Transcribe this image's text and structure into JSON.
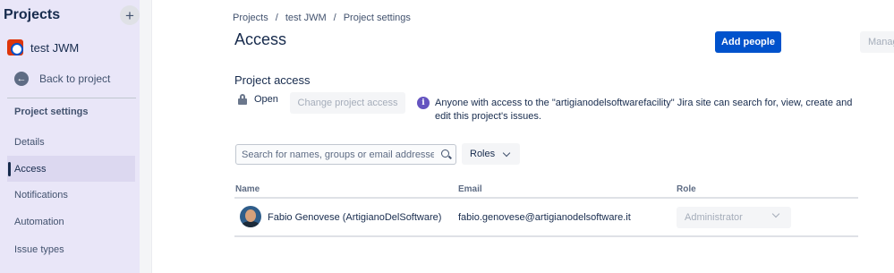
{
  "sidebar": {
    "header": "Projects",
    "add_label": "+",
    "project_name": "test JWM",
    "back_label": "Back to project",
    "section_title": "Project settings",
    "items": [
      {
        "label": "Details"
      },
      {
        "label": "Access"
      },
      {
        "label": "Notifications"
      },
      {
        "label": "Automation"
      },
      {
        "label": "Issue types"
      }
    ],
    "active_item": "Access"
  },
  "breadcrumb": [
    "Projects",
    "/",
    "test JWM",
    "/",
    "Project settings"
  ],
  "page": {
    "title": "Access",
    "add_people_label": "Add people",
    "manage_label": "Manag"
  },
  "project_access": {
    "title": "Project access",
    "status": "Open",
    "change_label": "Change project access",
    "info_text": "Anyone with access to the \"artigianodelsoftwarefacility\" Jira site can search for, view, create and edit this project's issues."
  },
  "filters": {
    "search_placeholder": "Search for names, groups or email addresses",
    "roles_label": "Roles"
  },
  "table": {
    "headers": {
      "name": "Name",
      "email": "Email",
      "role": "Role"
    },
    "rows": [
      {
        "name": "Fabio Genovese (ArtigianoDelSoftware)",
        "email": "fabio.genovese@artigianodelsoftware.it",
        "role": "Administrator"
      }
    ]
  },
  "colors": {
    "primary": "#0052cc",
    "sidebar_bg": "#e9e6f8",
    "info": "#6554c0"
  },
  "icons": [
    "plus-icon",
    "project-avatar-icon",
    "arrow-left-icon",
    "lock-icon",
    "info-icon",
    "search-icon",
    "chevron-down-icon"
  ]
}
